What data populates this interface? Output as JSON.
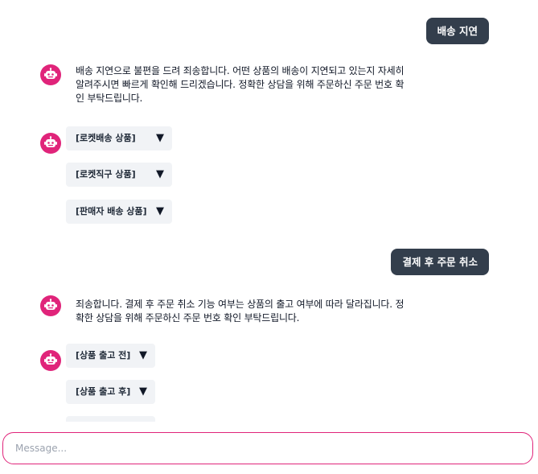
{
  "messages": [
    {
      "role": "user",
      "text": "배송 지연"
    },
    {
      "role": "bot",
      "text": "배송 지연으로 불편을 드려 죄송합니다. 어떤 상품의 배송이 지연되고 있는지 자세히 알려주시면 빠르게 확인해 드리겠습니다. 정확한 상담을 위해 주문하신 주문 번호 확인 부탁드립니다.",
      "options": [
        {
          "label": "[로켓배송 상품]",
          "icon": "caret-down-icon"
        },
        {
          "label": "[로켓직구 상품]",
          "icon": "caret-down-icon"
        },
        {
          "label": "[판매자 배송 상품]",
          "icon": "caret-down-icon"
        }
      ]
    },
    {
      "role": "user",
      "text": "결제 후 주문 취소"
    },
    {
      "role": "bot",
      "text": "죄송합니다. 결제 후 주문 취소 기능 여부는 상품의 출고 여부에 따라 달라집니다. 정확한 상담을 위해 주문하신 주문 번호 확인 부탁드립니다.",
      "options": [
        {
          "label": "[상품 출고 전]",
          "icon": "caret-down-icon"
        },
        {
          "label": "[상품 출고 후]",
          "icon": "caret-down-icon"
        }
      ]
    }
  ],
  "composer": {
    "placeholder": "Message..."
  },
  "colors": {
    "user_bubble": "#333e4c",
    "bot_avatar": "#e0247a",
    "option_bg": "#f1f3f6",
    "composer_border": "#e0247a"
  },
  "icons": {
    "bot_avatar": "robot-icon",
    "option_toggle": "caret-down-icon"
  }
}
